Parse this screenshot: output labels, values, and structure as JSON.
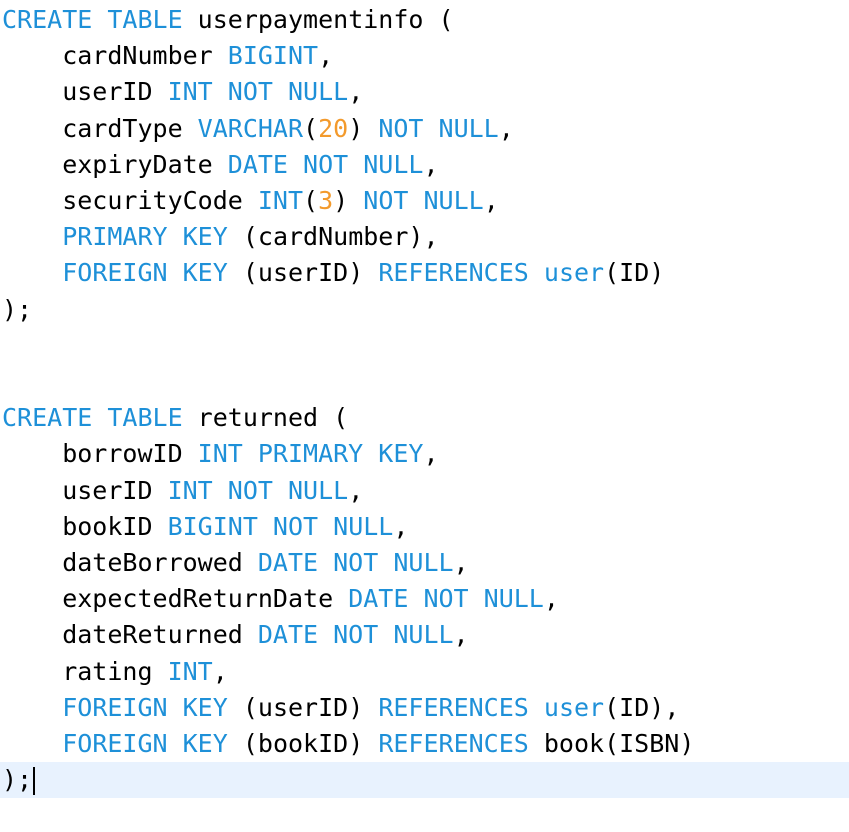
{
  "colors": {
    "keyword": "#1e90d8",
    "number": "#f39a2c",
    "identifier": "#000000",
    "current_line_highlight": "#e8f2fe"
  },
  "lines": [
    [
      {
        "t": "CREATE TABLE",
        "k": "kw"
      },
      {
        "t": " userpaymentinfo (",
        "k": "id"
      }
    ],
    [
      {
        "t": "    cardNumber ",
        "k": "id"
      },
      {
        "t": "BIGINT",
        "k": "kw"
      },
      {
        "t": ",",
        "k": "id"
      }
    ],
    [
      {
        "t": "    userID ",
        "k": "id"
      },
      {
        "t": "INT NOT NULL",
        "k": "kw"
      },
      {
        "t": ",",
        "k": "id"
      }
    ],
    [
      {
        "t": "    cardType ",
        "k": "id"
      },
      {
        "t": "VARCHAR",
        "k": "kw"
      },
      {
        "t": "(",
        "k": "id"
      },
      {
        "t": "20",
        "k": "num"
      },
      {
        "t": ") ",
        "k": "id"
      },
      {
        "t": "NOT NULL",
        "k": "kw"
      },
      {
        "t": ",",
        "k": "id"
      }
    ],
    [
      {
        "t": "    expiryDate ",
        "k": "id"
      },
      {
        "t": "DATE NOT NULL",
        "k": "kw"
      },
      {
        "t": ",",
        "k": "id"
      }
    ],
    [
      {
        "t": "    securityCode ",
        "k": "id"
      },
      {
        "t": "INT",
        "k": "kw"
      },
      {
        "t": "(",
        "k": "id"
      },
      {
        "t": "3",
        "k": "num"
      },
      {
        "t": ") ",
        "k": "id"
      },
      {
        "t": "NOT NULL",
        "k": "kw"
      },
      {
        "t": ",",
        "k": "id"
      }
    ],
    [
      {
        "t": "    ",
        "k": "id"
      },
      {
        "t": "PRIMARY KEY",
        "k": "kw"
      },
      {
        "t": " (cardNumber),",
        "k": "id"
      }
    ],
    [
      {
        "t": "    ",
        "k": "id"
      },
      {
        "t": "FOREIGN KEY",
        "k": "kw"
      },
      {
        "t": " (userID) ",
        "k": "id"
      },
      {
        "t": "REFERENCES",
        "k": "kw"
      },
      {
        "t": " ",
        "k": "id"
      },
      {
        "t": "user",
        "k": "kw"
      },
      {
        "t": "(ID)",
        "k": "id"
      }
    ],
    [
      {
        "t": ");",
        "k": "id"
      }
    ],
    [],
    [],
    [
      {
        "t": "CREATE TABLE",
        "k": "kw"
      },
      {
        "t": " returned (",
        "k": "id"
      }
    ],
    [
      {
        "t": "    borrowID ",
        "k": "id"
      },
      {
        "t": "INT PRIMARY KEY",
        "k": "kw"
      },
      {
        "t": ",",
        "k": "id"
      }
    ],
    [
      {
        "t": "    userID ",
        "k": "id"
      },
      {
        "t": "INT NOT NULL",
        "k": "kw"
      },
      {
        "t": ",",
        "k": "id"
      }
    ],
    [
      {
        "t": "    bookID ",
        "k": "id"
      },
      {
        "t": "BIGINT NOT NULL",
        "k": "kw"
      },
      {
        "t": ",",
        "k": "id"
      }
    ],
    [
      {
        "t": "    dateBorrowed ",
        "k": "id"
      },
      {
        "t": "DATE NOT NULL",
        "k": "kw"
      },
      {
        "t": ",",
        "k": "id"
      }
    ],
    [
      {
        "t": "    expectedReturnDate ",
        "k": "id"
      },
      {
        "t": "DATE NOT NULL",
        "k": "kw"
      },
      {
        "t": ",",
        "k": "id"
      }
    ],
    [
      {
        "t": "    dateReturned ",
        "k": "id"
      },
      {
        "t": "DATE NOT NULL",
        "k": "kw"
      },
      {
        "t": ",",
        "k": "id"
      }
    ],
    [
      {
        "t": "    rating ",
        "k": "id"
      },
      {
        "t": "INT",
        "k": "kw"
      },
      {
        "t": ",",
        "k": "id"
      }
    ],
    [
      {
        "t": "    ",
        "k": "id"
      },
      {
        "t": "FOREIGN KEY",
        "k": "kw"
      },
      {
        "t": " (userID) ",
        "k": "id"
      },
      {
        "t": "REFERENCES",
        "k": "kw"
      },
      {
        "t": " ",
        "k": "id"
      },
      {
        "t": "user",
        "k": "kw"
      },
      {
        "t": "(ID),",
        "k": "id"
      }
    ],
    [
      {
        "t": "    ",
        "k": "id"
      },
      {
        "t": "FOREIGN KEY",
        "k": "kw"
      },
      {
        "t": " (bookID) ",
        "k": "id"
      },
      {
        "t": "REFERENCES",
        "k": "kw"
      },
      {
        "t": " book(ISBN)",
        "k": "id"
      }
    ],
    [
      {
        "t": ");",
        "k": "id"
      }
    ]
  ],
  "current_line": 21
}
